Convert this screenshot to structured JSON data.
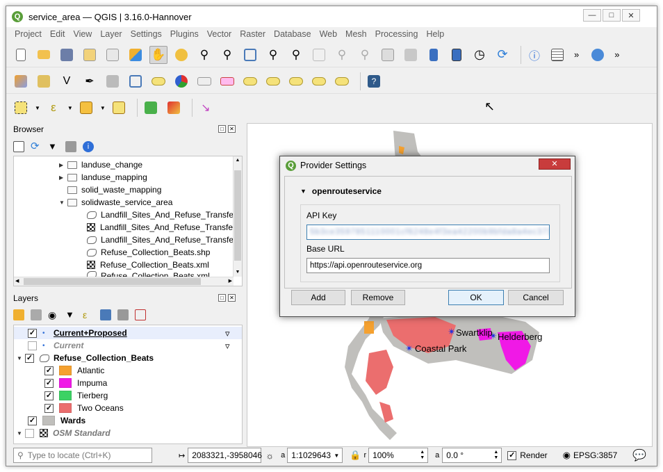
{
  "window": {
    "title": "service_area — QGIS | 3.16.0-Hannover",
    "logo": "Q"
  },
  "menu": [
    "Project",
    "Edit",
    "View",
    "Layer",
    "Settings",
    "Plugins",
    "Vector",
    "Raster",
    "Database",
    "Web",
    "Mesh",
    "Processing",
    "Help"
  ],
  "browser": {
    "title": "Browser",
    "items": [
      {
        "label": "landuse_change",
        "type": "folder",
        "indent": 1,
        "arrow": "▶"
      },
      {
        "label": "landuse_mapping",
        "type": "folder",
        "indent": 1,
        "arrow": "▶"
      },
      {
        "label": "solid_waste_mapping",
        "type": "folder",
        "indent": 1,
        "arrow": ""
      },
      {
        "label": "solidwaste_service_area",
        "type": "folder",
        "indent": 1,
        "arrow": "▼"
      },
      {
        "label": "Landfill_Sites_And_Refuse_Transfer_",
        "type": "shape",
        "indent": 2,
        "arrow": ""
      },
      {
        "label": "Landfill_Sites_And_Refuse_Transfer_",
        "type": "raster",
        "indent": 2,
        "arrow": ""
      },
      {
        "label": "Landfill_Sites_And_Refuse_Transfer_",
        "type": "shape",
        "indent": 2,
        "arrow": ""
      },
      {
        "label": "Refuse_Collection_Beats.shp",
        "type": "shape",
        "indent": 2,
        "arrow": ""
      },
      {
        "label": "Refuse_Collection_Beats.xml",
        "type": "raster",
        "indent": 2,
        "arrow": ""
      },
      {
        "label": "Refuse_Collection_Beats.xml",
        "type": "shape",
        "indent": 2,
        "arrow": ""
      }
    ]
  },
  "layers": {
    "title": "Layers",
    "items": [
      {
        "label": "Current+Proposed",
        "checked": true,
        "style": "bold-underline",
        "indent": 0
      },
      {
        "label": "Current",
        "checked": false,
        "style": "italic-grey",
        "indent": 0
      },
      {
        "label": "Refuse_Collection_Beats",
        "checked": true,
        "style": "bold",
        "indent": 0,
        "arrow": "▼"
      },
      {
        "label": "Atlantic",
        "checked": true,
        "style": "normal",
        "indent": 1,
        "color": "#f5a130"
      },
      {
        "label": "Impuma",
        "checked": true,
        "style": "normal",
        "indent": 1,
        "color": "#f019e6"
      },
      {
        "label": "Tierberg",
        "checked": true,
        "style": "normal",
        "indent": 1,
        "color": "#3cd264"
      },
      {
        "label": "Two Oceans",
        "checked": true,
        "style": "normal",
        "indent": 1,
        "color": "#eb6e6e"
      },
      {
        "label": "Wards",
        "checked": true,
        "style": "bold",
        "indent": 0,
        "color": "#c0bfbc"
      },
      {
        "label": "OSM Standard",
        "checked": false,
        "style": "italic-bold-grey",
        "indent": 0,
        "arrow": "▼"
      }
    ]
  },
  "map": {
    "labels": [
      {
        "text": "Swartklip"
      },
      {
        "text": "Helderberg"
      },
      {
        "text": "Coastal Park"
      }
    ]
  },
  "dialog": {
    "title": "Provider Settings",
    "provider": "openrouteservice",
    "api_key_label": "API Key",
    "api_key_value": "5b3ce3597851110001cf6248e4f3ea42200b9bfda8a4ec3733e1f",
    "base_url_label": "Base URL",
    "base_url_value": "https://api.openrouteservice.org",
    "buttons": {
      "add": "Add",
      "remove": "Remove",
      "ok": "OK",
      "cancel": "Cancel"
    }
  },
  "status": {
    "locate_placeholder": "Type to locate (Ctrl+K)",
    "coordinate": "2083321,-3958046",
    "scale": "1:1029643",
    "magnifier": "100%",
    "rotation": "0.0 °",
    "render_label": "Render",
    "crs": "EPSG:3857"
  },
  "colors": {
    "atlantic": "#f5a130",
    "impuma": "#f019e6",
    "tierberg": "#3cd264",
    "two_oceans": "#eb6e6e",
    "wards": "#c0bfbc"
  }
}
